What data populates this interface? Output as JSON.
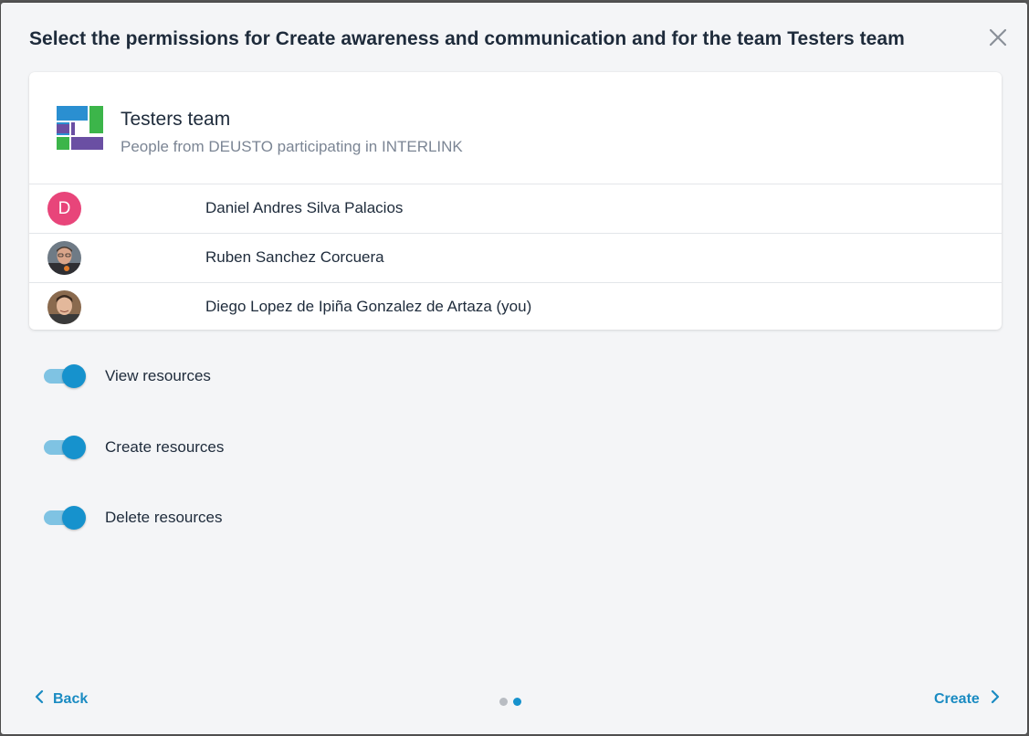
{
  "dialog": {
    "title": "Select the permissions for Create awareness and communication and for the team Testers team"
  },
  "team": {
    "name": "Testers team",
    "description": "People from DEUSTO participating in INTERLINK",
    "logo_icon": "team-logo-icon"
  },
  "members": [
    {
      "name": "Daniel Andres Silva Palacios",
      "avatar_letter": "D",
      "avatar_color": "#e8457a"
    },
    {
      "name": "Ruben Sanchez Corcuera",
      "avatar_letter": "",
      "avatar_color": ""
    },
    {
      "name": "Diego Lopez de Ipiña Gonzalez de Artaza (you)",
      "avatar_letter": "",
      "avatar_color": ""
    }
  ],
  "permissions": [
    {
      "label": "View resources",
      "enabled": true
    },
    {
      "label": "Create resources",
      "enabled": true
    },
    {
      "label": "Delete resources",
      "enabled": true
    }
  ],
  "footer": {
    "back_label": "Back",
    "create_label": "Create",
    "steps_total": 2,
    "current_step": 2
  },
  "colors": {
    "accent": "#1692cd",
    "toggle_track": "#7fc3e3",
    "link": "#1a8bc2",
    "dot_inactive": "#b8bcc2"
  }
}
